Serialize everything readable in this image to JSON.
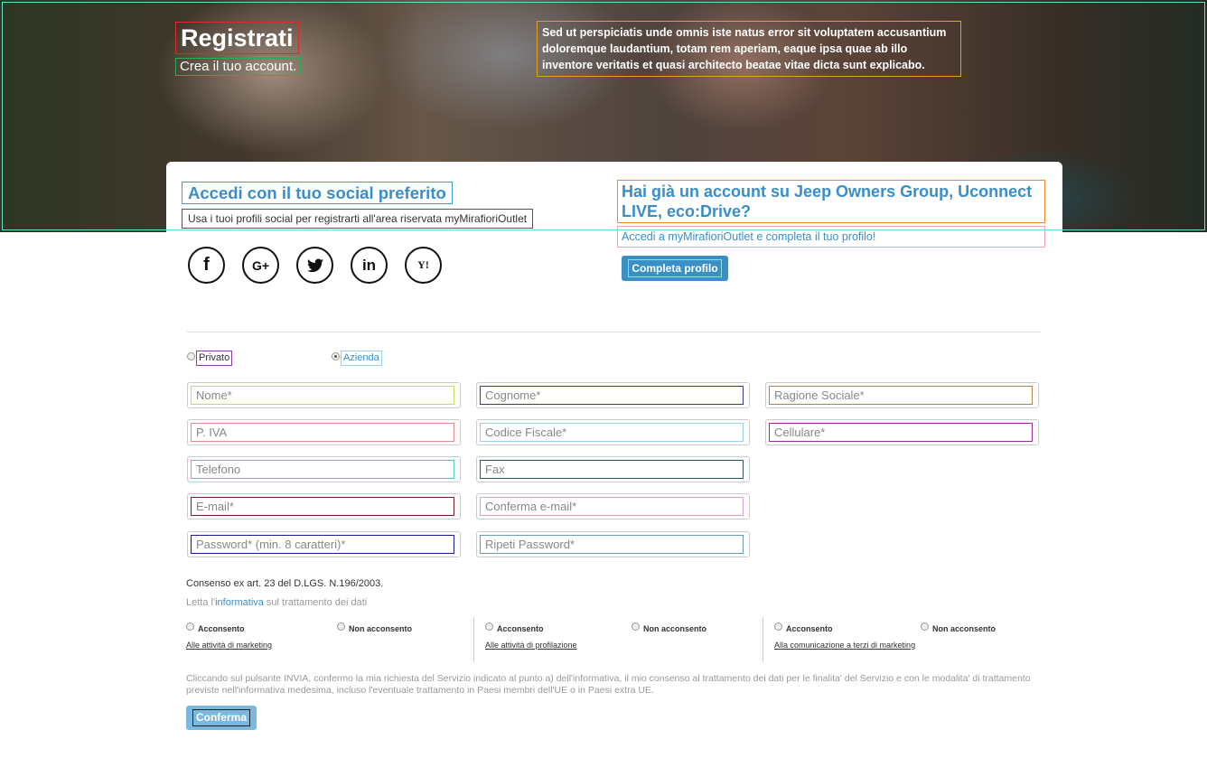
{
  "hero": {
    "title": "Registrati",
    "subtitle": "Crea il tuo account.",
    "text": "Sed ut perspiciatis unde omnis iste natus error sit voluptatem accusantium doloremque laudantium, totam rem aperiam, eaque ipsa quae ab illo inventore veritatis et quasi architecto beatae vitae dicta sunt explicabo."
  },
  "social": {
    "title": "Accedi con il tuo social preferito",
    "subtitle": "Usa i tuoi profili social per registrarti all'area riservata myMirafioriOutlet",
    "icons": [
      "facebook-icon",
      "google-plus-icon",
      "twitter-icon",
      "linkedin-icon",
      "yahoo-icon"
    ],
    "glyphs": [
      "f",
      "G+",
      "🐦",
      "in",
      "Y!"
    ]
  },
  "account": {
    "title": "Hai già un account su Jeep Owners Group, Uconnect LIVE, eco:Drive?",
    "subtitle": "Accedi a myMirafioriOutlet e completa il tuo profilo!",
    "button": "Completa profilo"
  },
  "user_type": {
    "options": [
      "Privato",
      "Azienda"
    ],
    "selected": "Azienda"
  },
  "form": {
    "nome": "Nome*",
    "cognome": "Cognome*",
    "ragione_sociale": "Ragione Sociale*",
    "piva": "P. IVA",
    "codice_fiscale": "Codice Fiscale*",
    "cellulare": "Cellulare*",
    "telefono": "Telefono",
    "fax": "Fax",
    "email": "E-mail*",
    "conferma_email": "Conferma e-mail*",
    "password": "Password* (min. 8 caratteri)*",
    "ripeti_password": "Ripeti Password*"
  },
  "consent": {
    "title": "Consenso ex art. 23 del D.LGS. N.196/2003.",
    "info_prefix": "Letta l'",
    "info_link": "informativa",
    "info_suffix": " sul trattamento dei dati",
    "accept": "Acconsento",
    "decline": "Non acconsento",
    "groups": [
      "Alle attività di marketing",
      "Alle attività di profilazione",
      "Alla comunicazione a terzi di marketing"
    ]
  },
  "disclaimer": "Cliccando sul pulsante INVIA, confermo la mia richiesta del Servizio indicato al punto a) dell'informativa, il mio consenso al trattamento dei dati per le finalita' del Servizio e con le modalita' di trattamento previste nell'informativa medesima, incluso l'eventuale trattamento in Paesi membri dell'UE o in Paesi extra UE.",
  "confirm_button": "Conferma",
  "colors": {
    "accent": "#3a8ec8",
    "button": "#3a90c4",
    "confirm": "#7ab8e0"
  }
}
